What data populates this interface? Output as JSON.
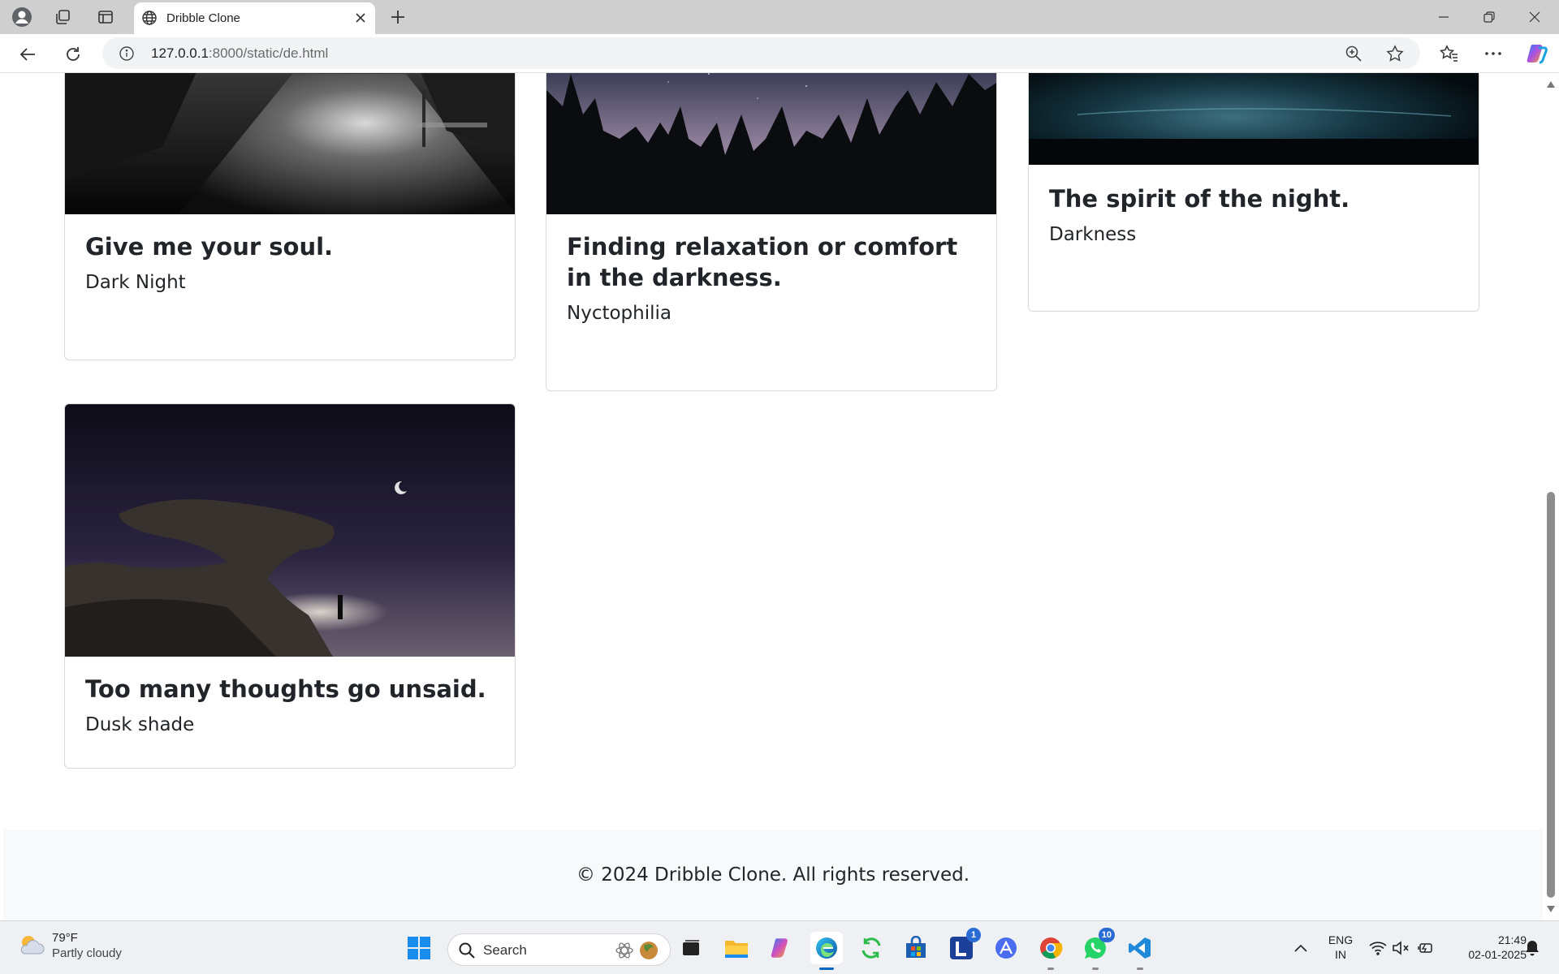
{
  "browser": {
    "tab_title": "Dribble Clone",
    "url_host": "127.0.0.1",
    "url_rest": ":8000/static/de.html"
  },
  "cards": [
    {
      "title": "Give me your soul.",
      "subtitle": "Dark Night"
    },
    {
      "title": "Finding relaxation or comfort in the darkness.",
      "subtitle": "Nyctophilia"
    },
    {
      "title": "The spirit of the night.",
      "subtitle": "Darkness"
    },
    {
      "title": "Too many thoughts go unsaid.",
      "subtitle": "Dusk shade"
    }
  ],
  "footer": {
    "text": "© 2024 Dribble Clone. All rights reserved."
  },
  "taskbar": {
    "weather_temp": "79°F",
    "weather_cond": "Partly cloudy",
    "search_label": "Search",
    "lang_top": "ENG",
    "lang_bottom": "IN",
    "time": "21:49",
    "date": "02-01-2025",
    "badge_l": "1",
    "badge_whatsapp": "10"
  }
}
